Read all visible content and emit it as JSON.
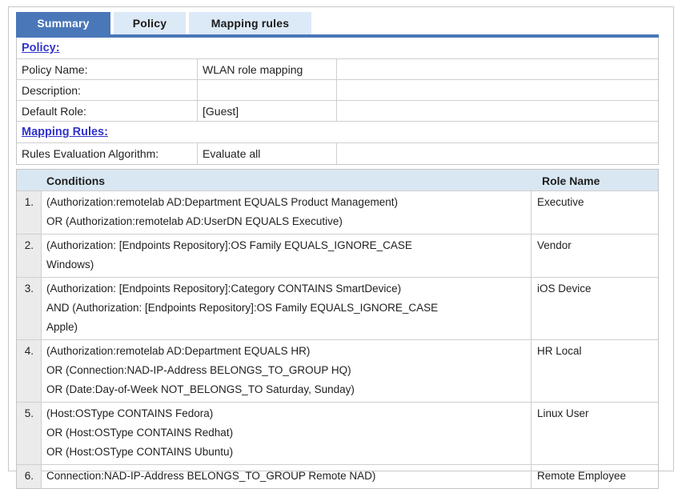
{
  "colors": {
    "accent_blue": "#4a77b8",
    "tab_inactive_bg": "#dce9f7",
    "rules_header_bg": "#d9e7f2",
    "number_column_bg": "#ebebeb",
    "link_blue": "#3233cb",
    "border_gray": "#c4c4c4"
  },
  "tabs": [
    {
      "label": "Summary",
      "active": true
    },
    {
      "label": "Policy",
      "active": false
    },
    {
      "label": "Mapping rules",
      "active": false
    }
  ],
  "policy_section": {
    "heading": "Policy:",
    "rows": [
      {
        "label": "Policy Name:",
        "value": "WLAN role mapping"
      },
      {
        "label": "Description:",
        "value": ""
      },
      {
        "label": "Default Role:",
        "value": "[Guest]"
      }
    ]
  },
  "mapping_section": {
    "heading": "Mapping Rules:",
    "rows": [
      {
        "label": "Rules Evaluation Algorithm:",
        "value": "Evaluate all"
      }
    ]
  },
  "rules_table": {
    "headers": {
      "conditions": "Conditions",
      "role_name": "Role Name"
    },
    "rows": [
      {
        "number": "1.",
        "conditions": "(Authorization:remotelab AD:Department EQUALS Product Management)\nOR (Authorization:remotelab AD:UserDN EQUALS Executive)",
        "role": "Executive"
      },
      {
        "number": "2.",
        "conditions": "(Authorization: [Endpoints Repository]:OS Family EQUALS_IGNORE_CASE\nWindows)",
        "role": "Vendor"
      },
      {
        "number": "3.",
        "conditions": "(Authorization: [Endpoints Repository]:Category CONTAINS SmartDevice)\nAND (Authorization: [Endpoints Repository]:OS Family EQUALS_IGNORE_CASE\nApple)",
        "role": "iOS Device"
      },
      {
        "number": "4.",
        "conditions": "(Authorization:remotelab AD:Department EQUALS HR)\nOR (Connection:NAD-IP-Address BELONGS_TO_GROUP HQ)\nOR (Date:Day-of-Week NOT_BELONGS_TO Saturday, Sunday)",
        "role": "HR Local"
      },
      {
        "number": "5.",
        "conditions": "(Host:OSType CONTAINS Fedora)\nOR (Host:OSType CONTAINS Redhat)\nOR (Host:OSType CONTAINS Ubuntu)",
        "role": "Linux User"
      },
      {
        "number": "6.",
        "conditions": "Connection:NAD-IP-Address BELONGS_TO_GROUP Remote NAD)",
        "role": "Remote Employee"
      }
    ]
  }
}
